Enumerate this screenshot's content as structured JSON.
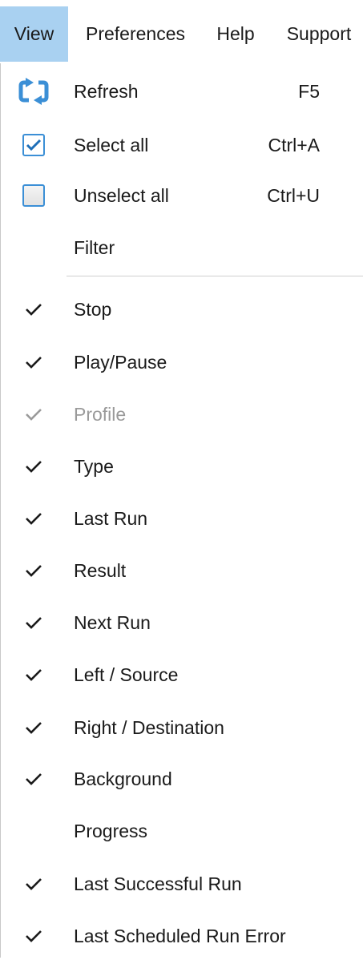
{
  "menubar": {
    "items": [
      {
        "label": "View",
        "active": true
      },
      {
        "label": "Preferences",
        "active": false
      },
      {
        "label": "Help",
        "active": false
      },
      {
        "label": "Support",
        "active": false
      }
    ]
  },
  "menu": {
    "items": [
      {
        "label": "Refresh",
        "shortcut": "F5",
        "icon": "refresh-icon"
      },
      {
        "label": "Select all",
        "shortcut": "Ctrl+A",
        "icon": "checked-checkbox-icon"
      },
      {
        "label": "Unselect all",
        "shortcut": "Ctrl+U",
        "icon": "unchecked-checkbox-icon"
      },
      {
        "label": "Filter"
      },
      {
        "label": "Stop",
        "checked": true
      },
      {
        "label": "Play/Pause",
        "checked": true
      },
      {
        "label": "Profile",
        "checked": true,
        "disabled": true
      },
      {
        "label": "Type",
        "checked": true
      },
      {
        "label": "Last Run",
        "checked": true
      },
      {
        "label": "Result",
        "checked": true
      },
      {
        "label": "Next Run",
        "checked": true
      },
      {
        "label": "Left / Source",
        "checked": true
      },
      {
        "label": "Right / Destination",
        "checked": true
      },
      {
        "label": "Background",
        "checked": true
      },
      {
        "label": "Progress",
        "checked": false
      },
      {
        "label": "Last Successful Run",
        "checked": true
      },
      {
        "label": "Last Scheduled Run Error",
        "checked": true
      }
    ]
  },
  "colors": {
    "active_menu_bg": "#a9d1f1",
    "icon_blue": "#3b8fd6",
    "disabled_text": "#9a9a9a"
  }
}
